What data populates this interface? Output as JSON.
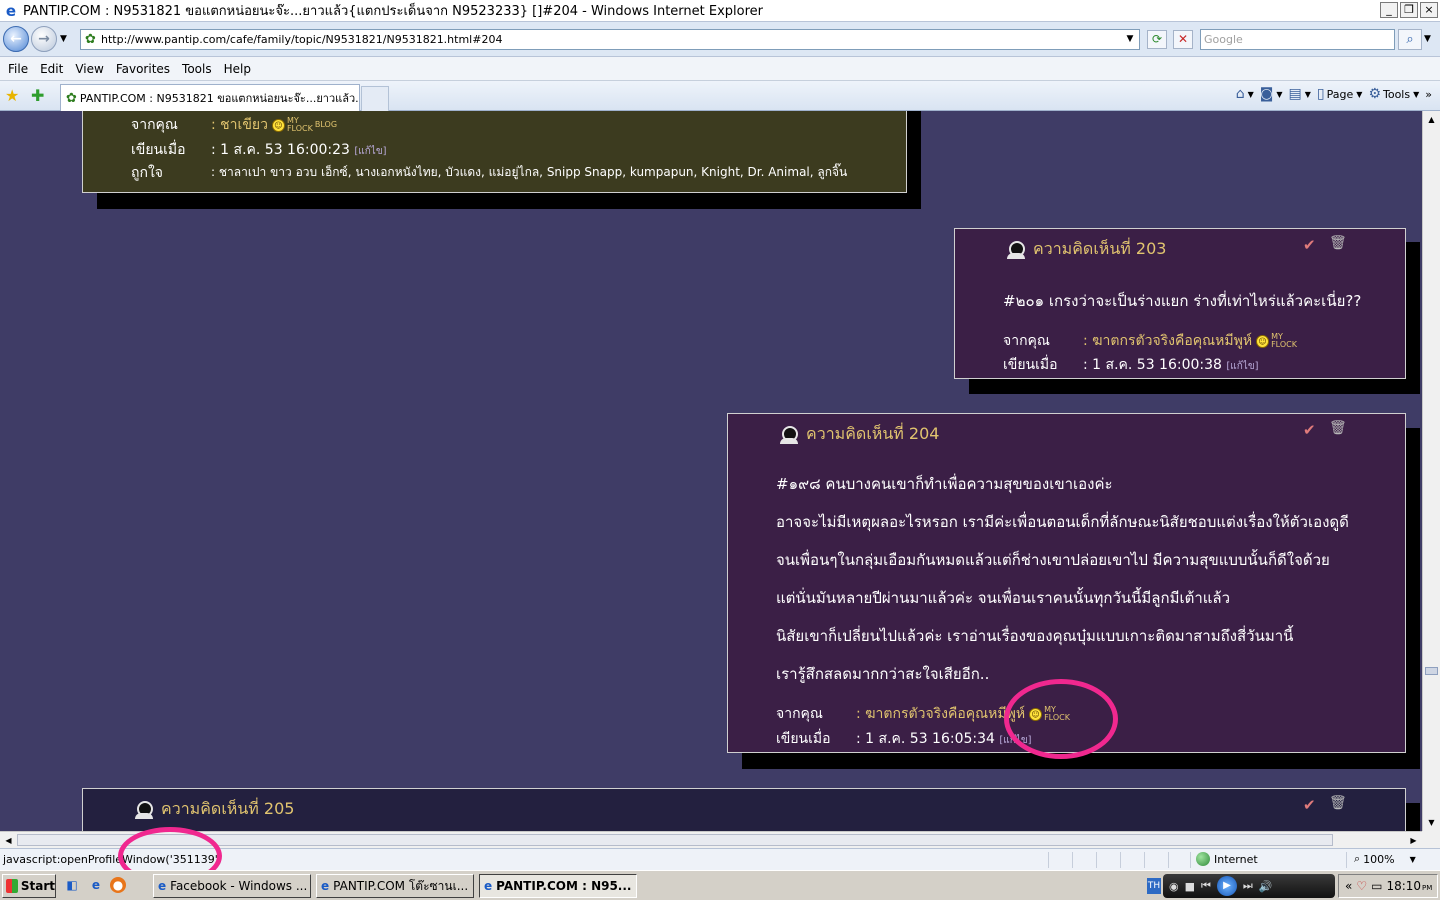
{
  "window": {
    "title": "PANTIP.COM : N9531821 ขอแตกหน่อยนะจ๊ะ...ยาวแล้ว{แตกประเด็นจาก N9523233} []#204 - Windows Internet Explorer",
    "controls": [
      "_",
      "❐",
      "×"
    ]
  },
  "address": {
    "url": "http://www.pantip.com/cafe/family/topic/N9531821/N9531821.html#204",
    "search_placeholder": "Google"
  },
  "menu": [
    "File",
    "Edit",
    "View",
    "Favorites",
    "Tools",
    "Help"
  ],
  "tab": {
    "title": "PANTIP.COM : N9531821 ขอแตกหน่อยนะจ๊ะ...ยาวแล้ว..."
  },
  "commandbar": {
    "page_label": "Page",
    "tools_label": "Tools"
  },
  "page": {
    "badge_my": "MY",
    "badge_flock": "FLOCK",
    "badge_blog": "BLOG",
    "edit_tag": "[แก้ไข]",
    "from_label": "จากคุณ",
    "written_label": "เขียนเมื่อ",
    "like_label": "ถูกใจ",
    "post_top": {
      "from": ": ชาเขียว",
      "written": ": 1 ส.ค. 53 16:00:23",
      "likes": ": ชาลาเปา ขาว อวบ เอ็กซ์, นางเอกหนังไทย, บัวแดง, แม่อยู่ไกล, Snipp Snapp, kumpapun, Knight, Dr. Animal, ลูกจิ๊น"
    },
    "post203": {
      "title": "ความคิดเห็นที่ 203",
      "body": "#๒๐๑ เกรงว่าจะเป็นร่างแยก ร่างที่เท่าไหร่แล้วคะเนี่ย??",
      "from": ": ฆาตกรตัวจริงคือคุณหมีพูห์",
      "written": ": 1 ส.ค. 53 16:00:38"
    },
    "post204": {
      "title": "ความคิดเห็นที่ 204",
      "lines": [
        "#๑๙๘ คนบางคนเขาก็ทำเพื่อความสุขของเขาเองค่ะ",
        "อาจจะไม่มีเหตุผลอะไรหรอก เรามีค่ะเพื่อนตอนเด็กที่ลักษณะนิสัยชอบแต่งเรื่องให้ตัวเองดูดี",
        "จนเพื่อนๆในกลุ่มเอือมกันหมดแล้วแต่ก็ช่างเขาปล่อยเขาไป มีความสุขแบบนั้นก็ดีใจด้วย",
        "แต่นั่นมันหลายปีผ่านมาแล้วค่ะ จนเพื่อนเราคนนั้นทุกวันนี้มีลูกมีเต้าแล้ว",
        "นิสัยเขาก็เปลี่ยนไปแล้วค่ะ เราอ่านเรื่องของคุณบุ๋มแบบเกาะติดมาสามถึงสี่วันมานี้",
        "เรารู้สึกสลดมากกว่าสะใจเสียอีก.."
      ],
      "from": ": ฆาตกรตัวจริงคือคุณหมีพูห์",
      "written": ": 1 ส.ค. 53 16:05:34"
    },
    "post205": {
      "title": "ความคิดเห็นที่ 205"
    }
  },
  "status": {
    "text": "javascript:openProfileWindow('351139')",
    "zone": "Internet",
    "zoom": "100%"
  },
  "taskbar": {
    "start": "Start",
    "items": [
      "Facebook - Windows ...",
      "PANTIP.COM โต๊ะซานเ...",
      "PANTIP.COM : N95..."
    ],
    "clock": "18:10",
    "clock_ampm": "PM",
    "lang": "TH"
  },
  "colors": {
    "page_bg": "#3f3c66",
    "post_plum": "#3b1f46",
    "post_olive": "#3c3b1f",
    "post_navy": "#23203f",
    "title_gold": "#e1c46f",
    "annotation": "#f0288f"
  }
}
